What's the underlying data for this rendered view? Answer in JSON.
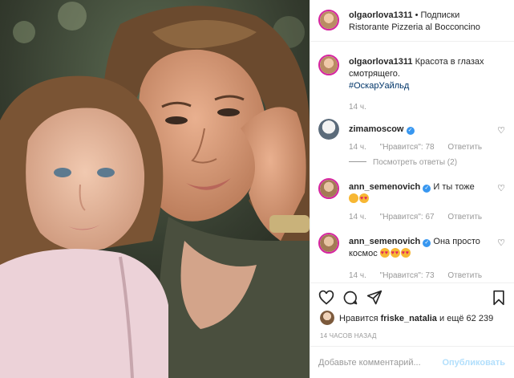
{
  "header": {
    "username": "olgaorlova1311",
    "dot": "•",
    "follow_label": "Подписки",
    "location": "Ristorante Pizzeria al Bocconcino"
  },
  "caption": {
    "username": "olgaorlova1311",
    "text": "Красота в глазах смотрящего.",
    "hashtag": "#ОскарУайльд",
    "time": "14 ч."
  },
  "comments": [
    {
      "username": "zimamoscow",
      "text": "",
      "time": "14 ч.",
      "likes": "\"Нравится\": 78",
      "reply": "Ответить",
      "view_replies": "Посмотреть ответы (2)"
    },
    {
      "username": "ann_semenovich",
      "text": "И ты тоже",
      "time": "14 ч.",
      "likes": "\"Нравится\": 67",
      "reply": "Ответить"
    },
    {
      "username": "ann_semenovich",
      "text": "Она просто космос",
      "time": "14 ч.",
      "likes": "\"Нравится\": 73",
      "reply": "Ответить"
    }
  ],
  "icons": {
    "like": "heart-icon",
    "comment": "comment-icon",
    "share": "share-icon",
    "save": "bookmark-icon",
    "verified": "verified-badge-icon",
    "emoji": "emoji-icon"
  },
  "likes": {
    "prefix": "Нравится",
    "user": "friske_natalia",
    "suffix": "и ещё 62 239"
  },
  "time_ago": "14 ЧАСОВ НАЗАД",
  "add_comment": {
    "placeholder": "Добавьте комментарий...",
    "post_label": "Опубликовать"
  },
  "colors": {
    "link": "#003569",
    "muted": "#999999",
    "post_disabled": "#b2dffc",
    "story_ring": "#d6249f",
    "verified": "#3897f0"
  }
}
